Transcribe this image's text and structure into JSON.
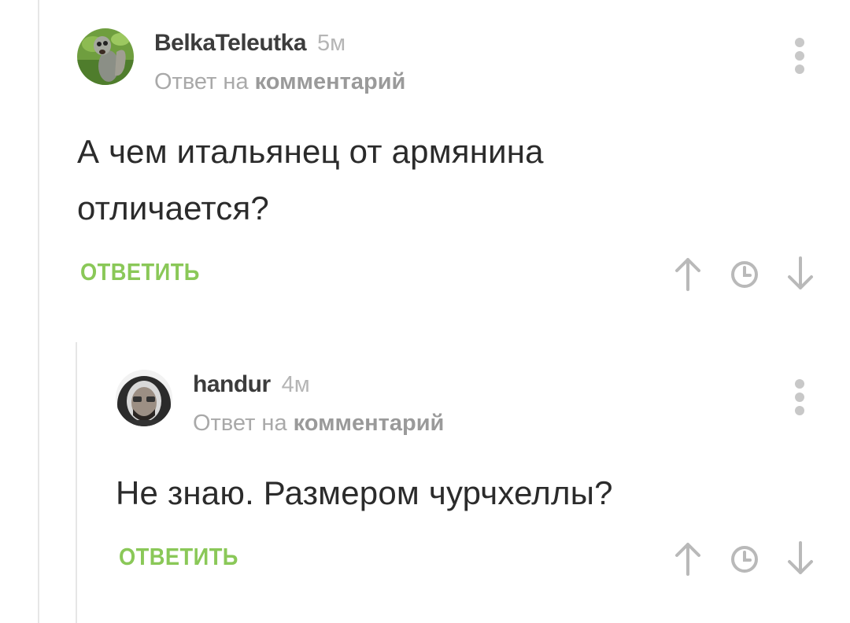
{
  "comments": [
    {
      "author": "BelkaTeleutka",
      "time": "5м",
      "reply_prefix": "Ответ на ",
      "reply_link": "комментарий",
      "text_lines": [
        "А чем итальянец от армянина",
        "отличается?"
      ],
      "reply_label": "ОТВЕТИТЬ",
      "avatar": "squirrel-photo"
    },
    {
      "author": "handur",
      "time": "4м",
      "reply_prefix": "Ответ на ",
      "reply_link": "комментарий",
      "text_lines": [
        "Не знаю. Размером чурчхеллы?"
      ],
      "reply_label": "ОТВЕТИТЬ",
      "avatar": "hooded-man-photo"
    }
  ],
  "icons": {
    "upvote": "arrow-up-icon",
    "time_sort": "clock-icon",
    "downvote": "arrow-down-icon",
    "more": "more-vertical-icon"
  },
  "colors": {
    "accent_green": "#8ac858",
    "text": "#2b2b2b",
    "muted": "#a9a9a9",
    "thread_line": "#e6e6e6"
  }
}
